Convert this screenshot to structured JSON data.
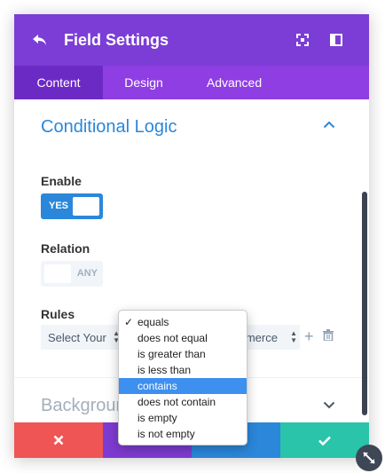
{
  "header": {
    "title": "Field Settings"
  },
  "tabs": [
    {
      "label": "Content",
      "active": true
    },
    {
      "label": "Design",
      "active": false
    },
    {
      "label": "Advanced",
      "active": false
    }
  ],
  "conditional_logic": {
    "title": "Conditional Logic",
    "enable_label": "Enable",
    "enable_toggle_text": "YES",
    "relation_label": "Relation",
    "relation_toggle_text": "ANY",
    "rules_label": "Rules",
    "rule_field_select": "Select Your",
    "rule_value_select": "mmerce"
  },
  "background_section": {
    "title": "Background"
  },
  "dropdown": {
    "options": [
      "equals",
      "does not equal",
      "is greater than",
      "is less than",
      "contains",
      "does not contain",
      "is empty",
      "is not empty"
    ],
    "checked": "equals",
    "highlighted": "contains"
  },
  "footer": {
    "cancel_icon": "x-icon",
    "undo_icon": "undo-icon",
    "redo_icon": "redo-icon",
    "save_icon": "check-icon"
  },
  "colors": {
    "header": "#7c3dd6",
    "tabs": "#8e3ee3",
    "accent": "#2b87da",
    "cancel": "#ef5555",
    "undo": "#7e3bd0",
    "redo": "#2b87da",
    "save": "#29c4a9",
    "highlight": "#3d8ff0"
  }
}
